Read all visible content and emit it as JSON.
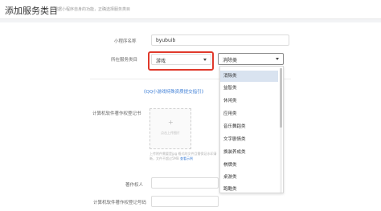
{
  "header": {
    "title": "添加服务类目",
    "subtitle": "请根据小程序自身的功能，正确选择服务类目"
  },
  "form": {
    "mini_program_name_label": "小程序名称",
    "mini_program_name_value": "byubuib",
    "category_label": "所在服务类目",
    "category_primary_value": "游戏",
    "category_secondary_value": "消除类",
    "qq_game_link": "《QQ小游戏特殊资质提交指引》",
    "software_copyright_label": "计算机软件著作权登记书",
    "upload_text": "点击上传图片",
    "upload_hint": "上传附件需要是jpg 格式的文件且需保证水印清晰，文件不超过5MB",
    "upload_hint_more": "查看示例",
    "copyright_owner_label": "著作权人",
    "copyright_reg_no_label": "计算机软件著作权登记号码"
  },
  "dropdown": {
    "options": [
      "消除类",
      "益智类",
      "休闲类",
      "应用类",
      "音乐舞蹈类",
      "文字剧情类",
      "换装养成类",
      "棋牌类",
      "桌游类",
      "跑酷类"
    ],
    "active_index": 0
  }
}
